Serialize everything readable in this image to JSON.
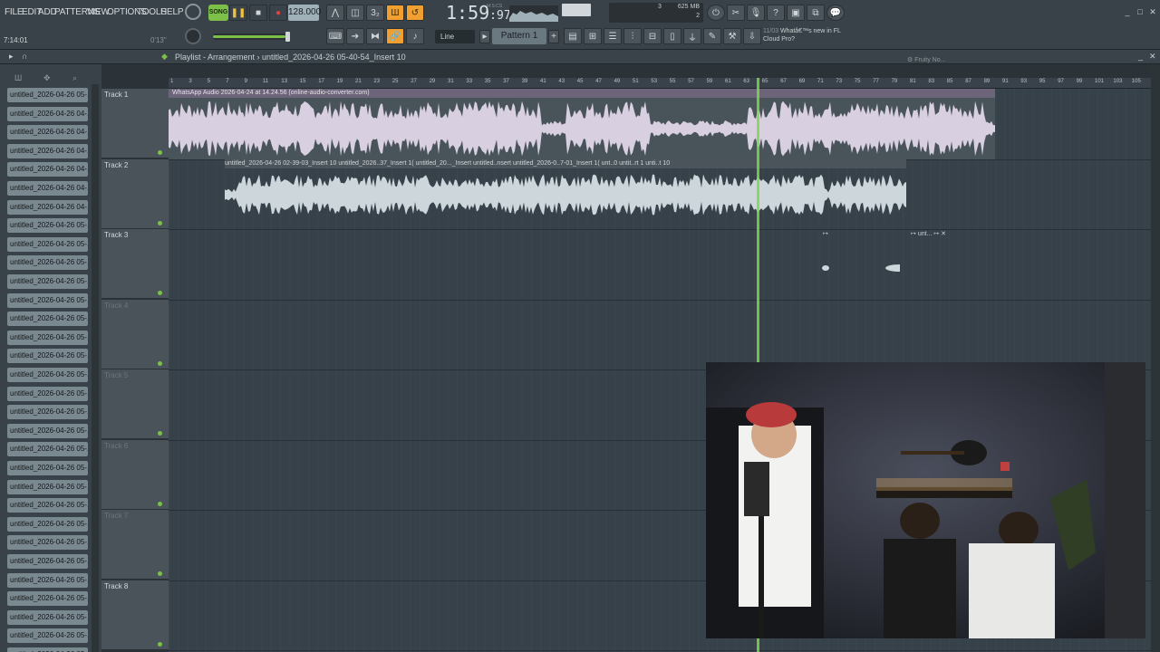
{
  "menu": [
    "FILE",
    "EDIT",
    "ADD",
    "PATTERNS",
    "VIEW",
    "OPTIONS",
    "TOOLS",
    "HELP"
  ],
  "transport": {
    "song_mode": "SONG",
    "tempo": "128.000",
    "time": "1:59",
    "time_sub": "97",
    "time_label": "M:S:CS"
  },
  "status": {
    "hint_time": "7:14:01",
    "hint_range": "0'13\""
  },
  "resources": {
    "voices": "3",
    "memory": "625 MB",
    "poly": "2"
  },
  "snap": "Line",
  "pattern": "Pattern 1",
  "news": {
    "date": "11/03",
    "line1": "Whatâ€™s new in FL",
    "line2": "Cloud Pro?"
  },
  "playlist": {
    "title": "Playlist - Arrangement",
    "crumb": "untitled_2026-04-26 05-40-54_Insert 10"
  },
  "fruity_tab": "Fruity No...",
  "ruler": [
    "1",
    "3",
    "5",
    "7",
    "9",
    "11",
    "13",
    "15",
    "17",
    "19",
    "21",
    "23",
    "25",
    "27",
    "29",
    "31",
    "33",
    "35",
    "37",
    "39",
    "41",
    "43",
    "45",
    "47",
    "49",
    "51",
    "53",
    "55",
    "57",
    "59",
    "61",
    "63",
    "65",
    "67",
    "69",
    "71",
    "73",
    "75",
    "77",
    "79",
    "81",
    "83",
    "85",
    "87",
    "89",
    "91",
    "93",
    "95",
    "97",
    "99",
    "101",
    "103",
    "105"
  ],
  "browser_items": [
    "untitled_2026-04-26 05-...",
    "untitled_2026-04-26 04-...",
    "untitled_2026-04-26 04-...",
    "untitled_2026-04-26 04-...",
    "untitled_2026-04-26 04-...",
    "untitled_2026-04-26 04-...",
    "untitled_2026-04-26 04-...",
    "untitled_2026-04-26 05-...",
    "untitled_2026-04-26 05-...",
    "untitled_2026-04-26 05-...",
    "untitled_2026-04-26 05-...",
    "untitled_2026-04-26 05-...",
    "untitled_2026-04-26 05-...",
    "untitled_2026-04-26 05-...",
    "untitled_2026-04-26 05-...",
    "untitled_2026-04-26 05-...",
    "untitled_2026-04-26 05-...",
    "untitled_2026-04-26 05-...",
    "untitled_2026-04-26 05-...",
    "untitled_2026-04-26 05-...",
    "untitled_2026-04-26 05-...",
    "untitled_2026-04-26 05-...",
    "untitled_2026-04-26 05-...",
    "untitled_2026-04-26 05-...",
    "untitled_2026-04-26 05-...",
    "untitled_2026-04-26 05-...",
    "untitled_2026-04-26 05-...",
    "untitled_2026-04-26 05-...",
    "untitled_2026-04-26 05-...",
    "untitled_2026-04-26 05-...",
    "untitled_2026-04-26 05-..."
  ],
  "tracks": [
    "Track 1",
    "Track 2",
    "Track 3",
    "Track 4",
    "Track 5",
    "Track 6",
    "Track 7",
    "Track 8"
  ],
  "clips": {
    "track1": "WhatsApp Audio 2026-04-24 at 14.24.56 (online-audio-converter.com)",
    "track2": "untitled_2026-04-26 02-39-03_Insert 10  untitled_2026..37_Insert 1(  untitled_20..._Insert  untitled..nsert  untitled_2026-0..7-01_Insert 1(  unt..0  untit..rt 1  unti..t 10",
    "track3": "unt..."
  },
  "colors": {
    "accent_green": "#7cc04a",
    "accent_orange": "#f0a030",
    "clip_header": "#6c6478",
    "waveform": "#d8d0e0"
  }
}
